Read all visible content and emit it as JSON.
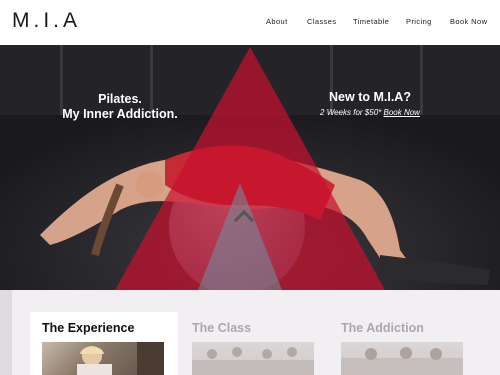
{
  "header": {
    "logo": "M.I.A",
    "nav": [
      {
        "label": "About"
      },
      {
        "label": "Classes"
      },
      {
        "label": "Timetable"
      },
      {
        "label": "Pricing"
      },
      {
        "label": "Book Now"
      }
    ]
  },
  "hero": {
    "tagline_line1": "Pilates.",
    "tagline_line2": "My Inner Addiction.",
    "promo_title": "New to M.I.A?",
    "promo_offer": "2 Weeks for $50* ",
    "promo_link": "Book Now"
  },
  "tabs": [
    {
      "label": "The Experience",
      "active": true
    },
    {
      "label": "The Class",
      "active": false
    },
    {
      "label": "The Addiction",
      "active": false
    }
  ],
  "colors": {
    "brand_red": "#c8102e",
    "header_bg": "#ffffff",
    "lower_bg": "#f1eff1",
    "inactive_tab_text": "#aaa8aa"
  }
}
